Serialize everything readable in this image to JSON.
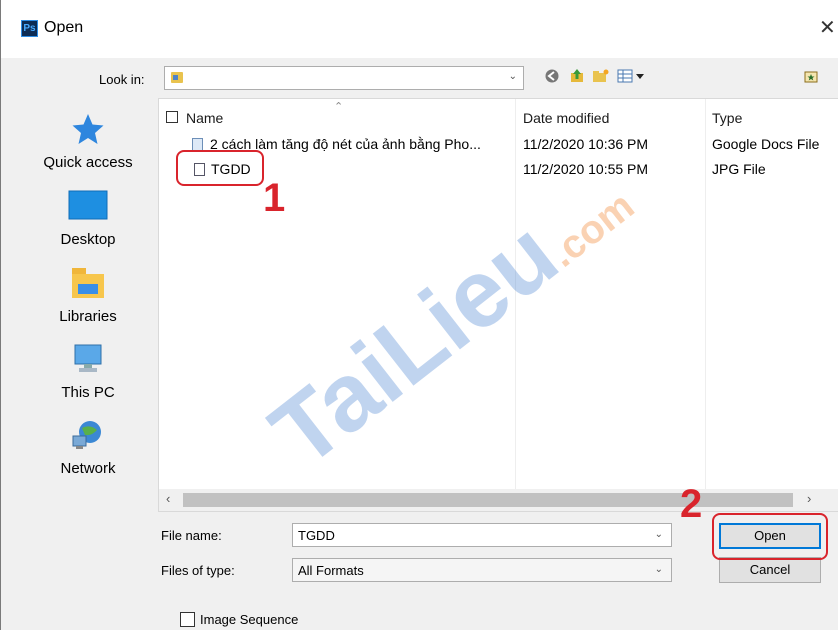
{
  "window": {
    "title": "Open",
    "app_icon_text": "Ps",
    "close_glyph": "✕"
  },
  "lookin": {
    "label": "Look in:",
    "value": ""
  },
  "sidebar": {
    "items": [
      {
        "label": "Quick access"
      },
      {
        "label": "Desktop"
      },
      {
        "label": "Libraries"
      },
      {
        "label": "This PC"
      },
      {
        "label": "Network"
      }
    ]
  },
  "table": {
    "headers": {
      "name": "Name",
      "date": "Date modified",
      "type": "Type"
    },
    "rows": [
      {
        "name": "2 cách làm tăng độ nét của ảnh bằng Pho...",
        "date": "11/2/2020 10:36 PM",
        "type": "Google Docs File"
      },
      {
        "name": "TGDD",
        "date": "11/2/2020 10:55 PM",
        "type": "JPG File"
      }
    ]
  },
  "filename": {
    "label": "File name:",
    "value": "TGDD"
  },
  "filetype": {
    "label": "Files of type:",
    "value": "All Formats"
  },
  "buttons": {
    "open": "Open",
    "cancel": "Cancel"
  },
  "image_sequence": {
    "label": "Image Sequence",
    "checked": false
  },
  "annotations": {
    "step1": "1",
    "step2": "2",
    "color": "#d9242c"
  },
  "watermark": {
    "text": "TaiLieu.com",
    "colors": [
      "#5b8fd6",
      "#f28b3a"
    ]
  },
  "colors": {
    "accent": "#0078d7",
    "window_bg": "#f0f0f0"
  }
}
